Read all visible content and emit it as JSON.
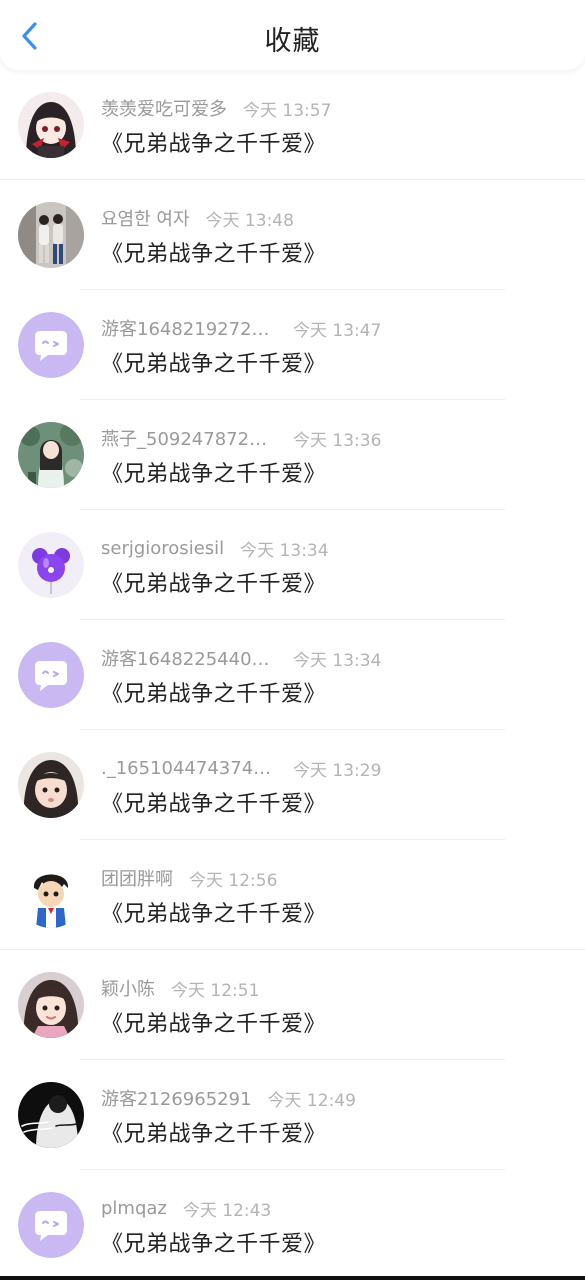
{
  "header": {
    "title": "收藏",
    "back_icon": "chevron-left-icon"
  },
  "colors": {
    "accent": "#3a8ef6",
    "default_avatar_bg": "#c9b8f2",
    "default_avatar_bubble": "#ffffff"
  },
  "items": [
    {
      "user": "羡羡爱吃可爱多",
      "time": "今天 13:57",
      "title": "《兄弟战争之千千爱》",
      "avatar": "anime-girl-avatar"
    },
    {
      "user": "요염한 여자",
      "time": "今天 13:48",
      "title": "《兄弟战争之千千爱》",
      "avatar": "two-girls-photo-avatar"
    },
    {
      "user": "游客1648219272…",
      "time": "今天 13:47",
      "title": "《兄弟战争之千千爱》",
      "avatar": "default-chat-avatar"
    },
    {
      "user": "燕子_509247872…",
      "time": "今天 13:36",
      "title": "《兄弟战争之千千爱》",
      "avatar": "garden-girl-avatar"
    },
    {
      "user": "serjgiorosiesil",
      "time": "今天 13:34",
      "title": "《兄弟战争之千千爱》",
      "avatar": "purple-balloon-avatar"
    },
    {
      "user": "游客1648225440…",
      "time": "今天 13:34",
      "title": "《兄弟战争之千千爱》",
      "avatar": "default-chat-avatar"
    },
    {
      "user": "._165104474374…",
      "time": "今天 13:29",
      "title": "《兄弟战争之千千爱》",
      "avatar": "child-photo-avatar"
    },
    {
      "user": "团团胖啊",
      "time": "今天 12:56",
      "title": "《兄弟战争之千千爱》",
      "avatar": "cartoon-boy-avatar"
    },
    {
      "user": "颖小陈",
      "time": "今天 12:51",
      "title": "《兄弟战争之千千爱》",
      "avatar": "little-girl-avatar"
    },
    {
      "user": "游客2126965291",
      "time": "今天 12:49",
      "title": "《兄弟战争之千千爱》",
      "avatar": "dark-calligraphy-avatar"
    },
    {
      "user": "plmqaz",
      "time": "今天 12:43",
      "title": "《兄弟战争之千千爱》",
      "avatar": "default-chat-avatar"
    }
  ]
}
